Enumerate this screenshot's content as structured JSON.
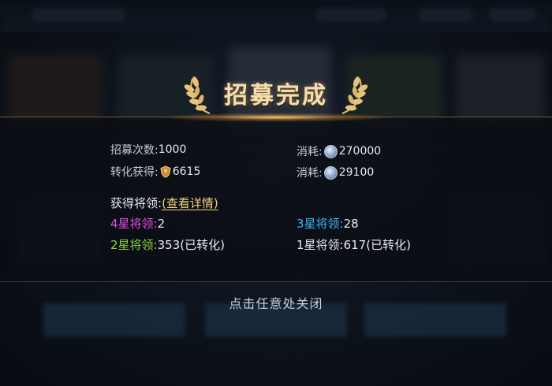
{
  "title": "招募完成",
  "stats": {
    "recruit_count_label": "招募次数:",
    "recruit_count_value": "1000",
    "convert_label": "转化获得:",
    "convert_value": "6615",
    "cost1_label": "消耗:",
    "cost1_value": "270000",
    "cost2_label": "消耗:",
    "cost2_value": "29100"
  },
  "generals": {
    "header_label": "获得将领:",
    "details_link": "(查看详情)",
    "star4_label": "4星将领:",
    "star4_value": "2",
    "star3_label": "3星将领:",
    "star3_value": "28",
    "star2_label": "2星将领:",
    "star2_value": "353(已转化)",
    "star1_label": "1星将领:",
    "star1_value": "617(已转化)"
  },
  "close_hint": "点击任意处关闭",
  "colors": {
    "star4": "#e64ae6",
    "star3": "#3ab8f0",
    "star2": "#8bd53a",
    "link": "#f2d27a",
    "title": "#f5dfb0"
  },
  "icons": {
    "laurel": "laurel-icon",
    "silver_coin": "silver-coin-icon",
    "shield_token": "shield-token-icon"
  }
}
